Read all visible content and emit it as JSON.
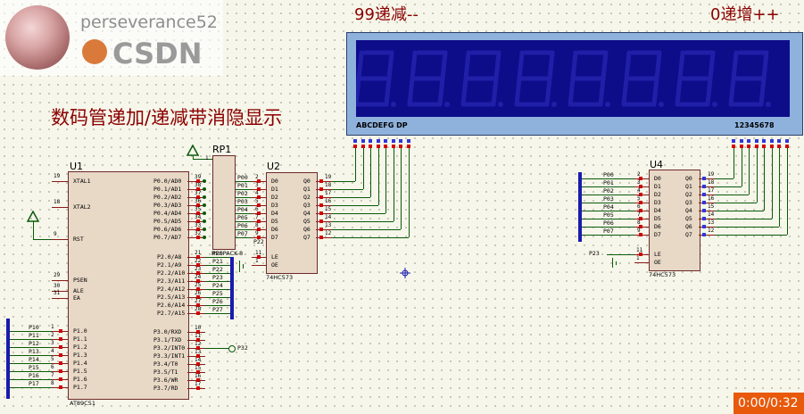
{
  "watermark": {
    "name": "perseverance52",
    "brand": "CSDN"
  },
  "title": "数码管递加/递减带消隐显示",
  "display": {
    "label_dec": "99递减--",
    "label_inc": "0递增++",
    "segments_label": "ABCDEFG DP",
    "digits_label": "12345678",
    "panel_color": "#0d0d8a",
    "bezel_color": "#8fb2dd"
  },
  "u1": {
    "ref": "U1",
    "part": "AT89C51",
    "left_pins": [
      {
        "num": "19",
        "name": "XTAL1"
      },
      {
        "num": "18",
        "name": "XTAL2"
      },
      {
        "num": "9",
        "name": "RST"
      },
      {
        "num": "29",
        "name": "PSEN"
      },
      {
        "num": "30",
        "name": "ALE"
      },
      {
        "num": "31",
        "name": "EA"
      }
    ],
    "p1_pins": [
      {
        "num": "1",
        "name": "P1.0",
        "net": "P10"
      },
      {
        "num": "2",
        "name": "P1.1",
        "net": "P11"
      },
      {
        "num": "3",
        "name": "P1.2",
        "net": "P12"
      },
      {
        "num": "4",
        "name": "P1.3",
        "net": "P13"
      },
      {
        "num": "5",
        "name": "P1.4",
        "net": "P14"
      },
      {
        "num": "6",
        "name": "P1.5",
        "net": "P15"
      },
      {
        "num": "7",
        "name": "P1.6",
        "net": "P16"
      },
      {
        "num": "8",
        "name": "P1.7",
        "net": "P17"
      }
    ],
    "p0_pins": [
      {
        "num": "39",
        "name": "P0.0/AD0"
      },
      {
        "num": "38",
        "name": "P0.1/AD1"
      },
      {
        "num": "37",
        "name": "P0.2/AD2"
      },
      {
        "num": "36",
        "name": "P0.3/AD3"
      },
      {
        "num": "35",
        "name": "P0.4/AD4"
      },
      {
        "num": "34",
        "name": "P0.5/AD5"
      },
      {
        "num": "33",
        "name": "P0.6/AD6"
      },
      {
        "num": "32",
        "name": "P0.7/AD7"
      }
    ],
    "p2_pins": [
      {
        "num": "21",
        "name": "P2.0/A8",
        "net": "P20"
      },
      {
        "num": "22",
        "name": "P2.1/A9",
        "net": "P21"
      },
      {
        "num": "23",
        "name": "P2.2/A10",
        "net": "P22"
      },
      {
        "num": "24",
        "name": "P2.3/A11",
        "net": "P23"
      },
      {
        "num": "25",
        "name": "P2.4/A12",
        "net": "P24"
      },
      {
        "num": "26",
        "name": "P2.5/A13",
        "net": "P25"
      },
      {
        "num": "27",
        "name": "P2.6/A14",
        "net": "P26"
      },
      {
        "num": "28",
        "name": "P2.7/A15",
        "net": "P27"
      }
    ],
    "p3_pins": [
      {
        "num": "10",
        "name": "P3.0/RXD"
      },
      {
        "num": "11",
        "name": "P3.1/TXD"
      },
      {
        "num": "12",
        "name": "P3.2/INT0"
      },
      {
        "num": "13",
        "name": "P3.3/INT1"
      },
      {
        "num": "14",
        "name": "P3.4/T0"
      },
      {
        "num": "15",
        "name": "P3.5/T1"
      },
      {
        "num": "16",
        "name": "P3.6/WR"
      },
      {
        "num": "17",
        "name": "P3.7/RD"
      }
    ],
    "p32_net": "P32"
  },
  "rp1": {
    "ref": "RP1",
    "part": "RESPACK-8",
    "pin1": "1"
  },
  "u2": {
    "ref": "U2",
    "part": "74HC573",
    "d_pins": [
      {
        "num": "2",
        "name": "D0",
        "net": "P00"
      },
      {
        "num": "3",
        "name": "D1",
        "net": "P01"
      },
      {
        "num": "4",
        "name": "D2",
        "net": "P02"
      },
      {
        "num": "5",
        "name": "D3",
        "net": "P03"
      },
      {
        "num": "6",
        "name": "D4",
        "net": "P04"
      },
      {
        "num": "7",
        "name": "D5",
        "net": "P05"
      },
      {
        "num": "8",
        "name": "D6",
        "net": "P06"
      },
      {
        "num": "9",
        "name": "D7",
        "net": "P07"
      }
    ],
    "q_pins": [
      {
        "num": "19",
        "name": "Q0"
      },
      {
        "num": "18",
        "name": "Q1"
      },
      {
        "num": "17",
        "name": "Q2"
      },
      {
        "num": "16",
        "name": "Q3"
      },
      {
        "num": "15",
        "name": "Q4"
      },
      {
        "num": "14",
        "name": "Q5"
      },
      {
        "num": "13",
        "name": "Q6"
      },
      {
        "num": "12",
        "name": "Q7"
      }
    ],
    "le": {
      "num": "11",
      "name": "LE",
      "net": "P22"
    },
    "oe": {
      "num": "1",
      "name": "OE"
    }
  },
  "u4": {
    "ref": "U4",
    "part": "74HC573",
    "d_pins": [
      {
        "num": "2",
        "name": "D0",
        "net": "P00"
      },
      {
        "num": "3",
        "name": "D1",
        "net": "P01"
      },
      {
        "num": "4",
        "name": "D2",
        "net": "P02"
      },
      {
        "num": "5",
        "name": "D3",
        "net": "P03"
      },
      {
        "num": "6",
        "name": "D4",
        "net": "P04"
      },
      {
        "num": "7",
        "name": "D5",
        "net": "P05"
      },
      {
        "num": "8",
        "name": "D6",
        "net": "P06"
      },
      {
        "num": "9",
        "name": "D7",
        "net": "P07"
      }
    ],
    "q_pins": [
      {
        "num": "19",
        "name": "Q0"
      },
      {
        "num": "18",
        "name": "Q1"
      },
      {
        "num": "17",
        "name": "Q2"
      },
      {
        "num": "16",
        "name": "Q3"
      },
      {
        "num": "15",
        "name": "Q4"
      },
      {
        "num": "14",
        "name": "Q5"
      },
      {
        "num": "13",
        "name": "Q6"
      },
      {
        "num": "12",
        "name": "Q7"
      }
    ],
    "le": {
      "num": "11",
      "name": "LE",
      "net": "P23"
    },
    "oe": {
      "num": "1",
      "name": "OE"
    }
  },
  "video": {
    "time": "0:00/0:32",
    "badge_color": "#e8590c"
  }
}
